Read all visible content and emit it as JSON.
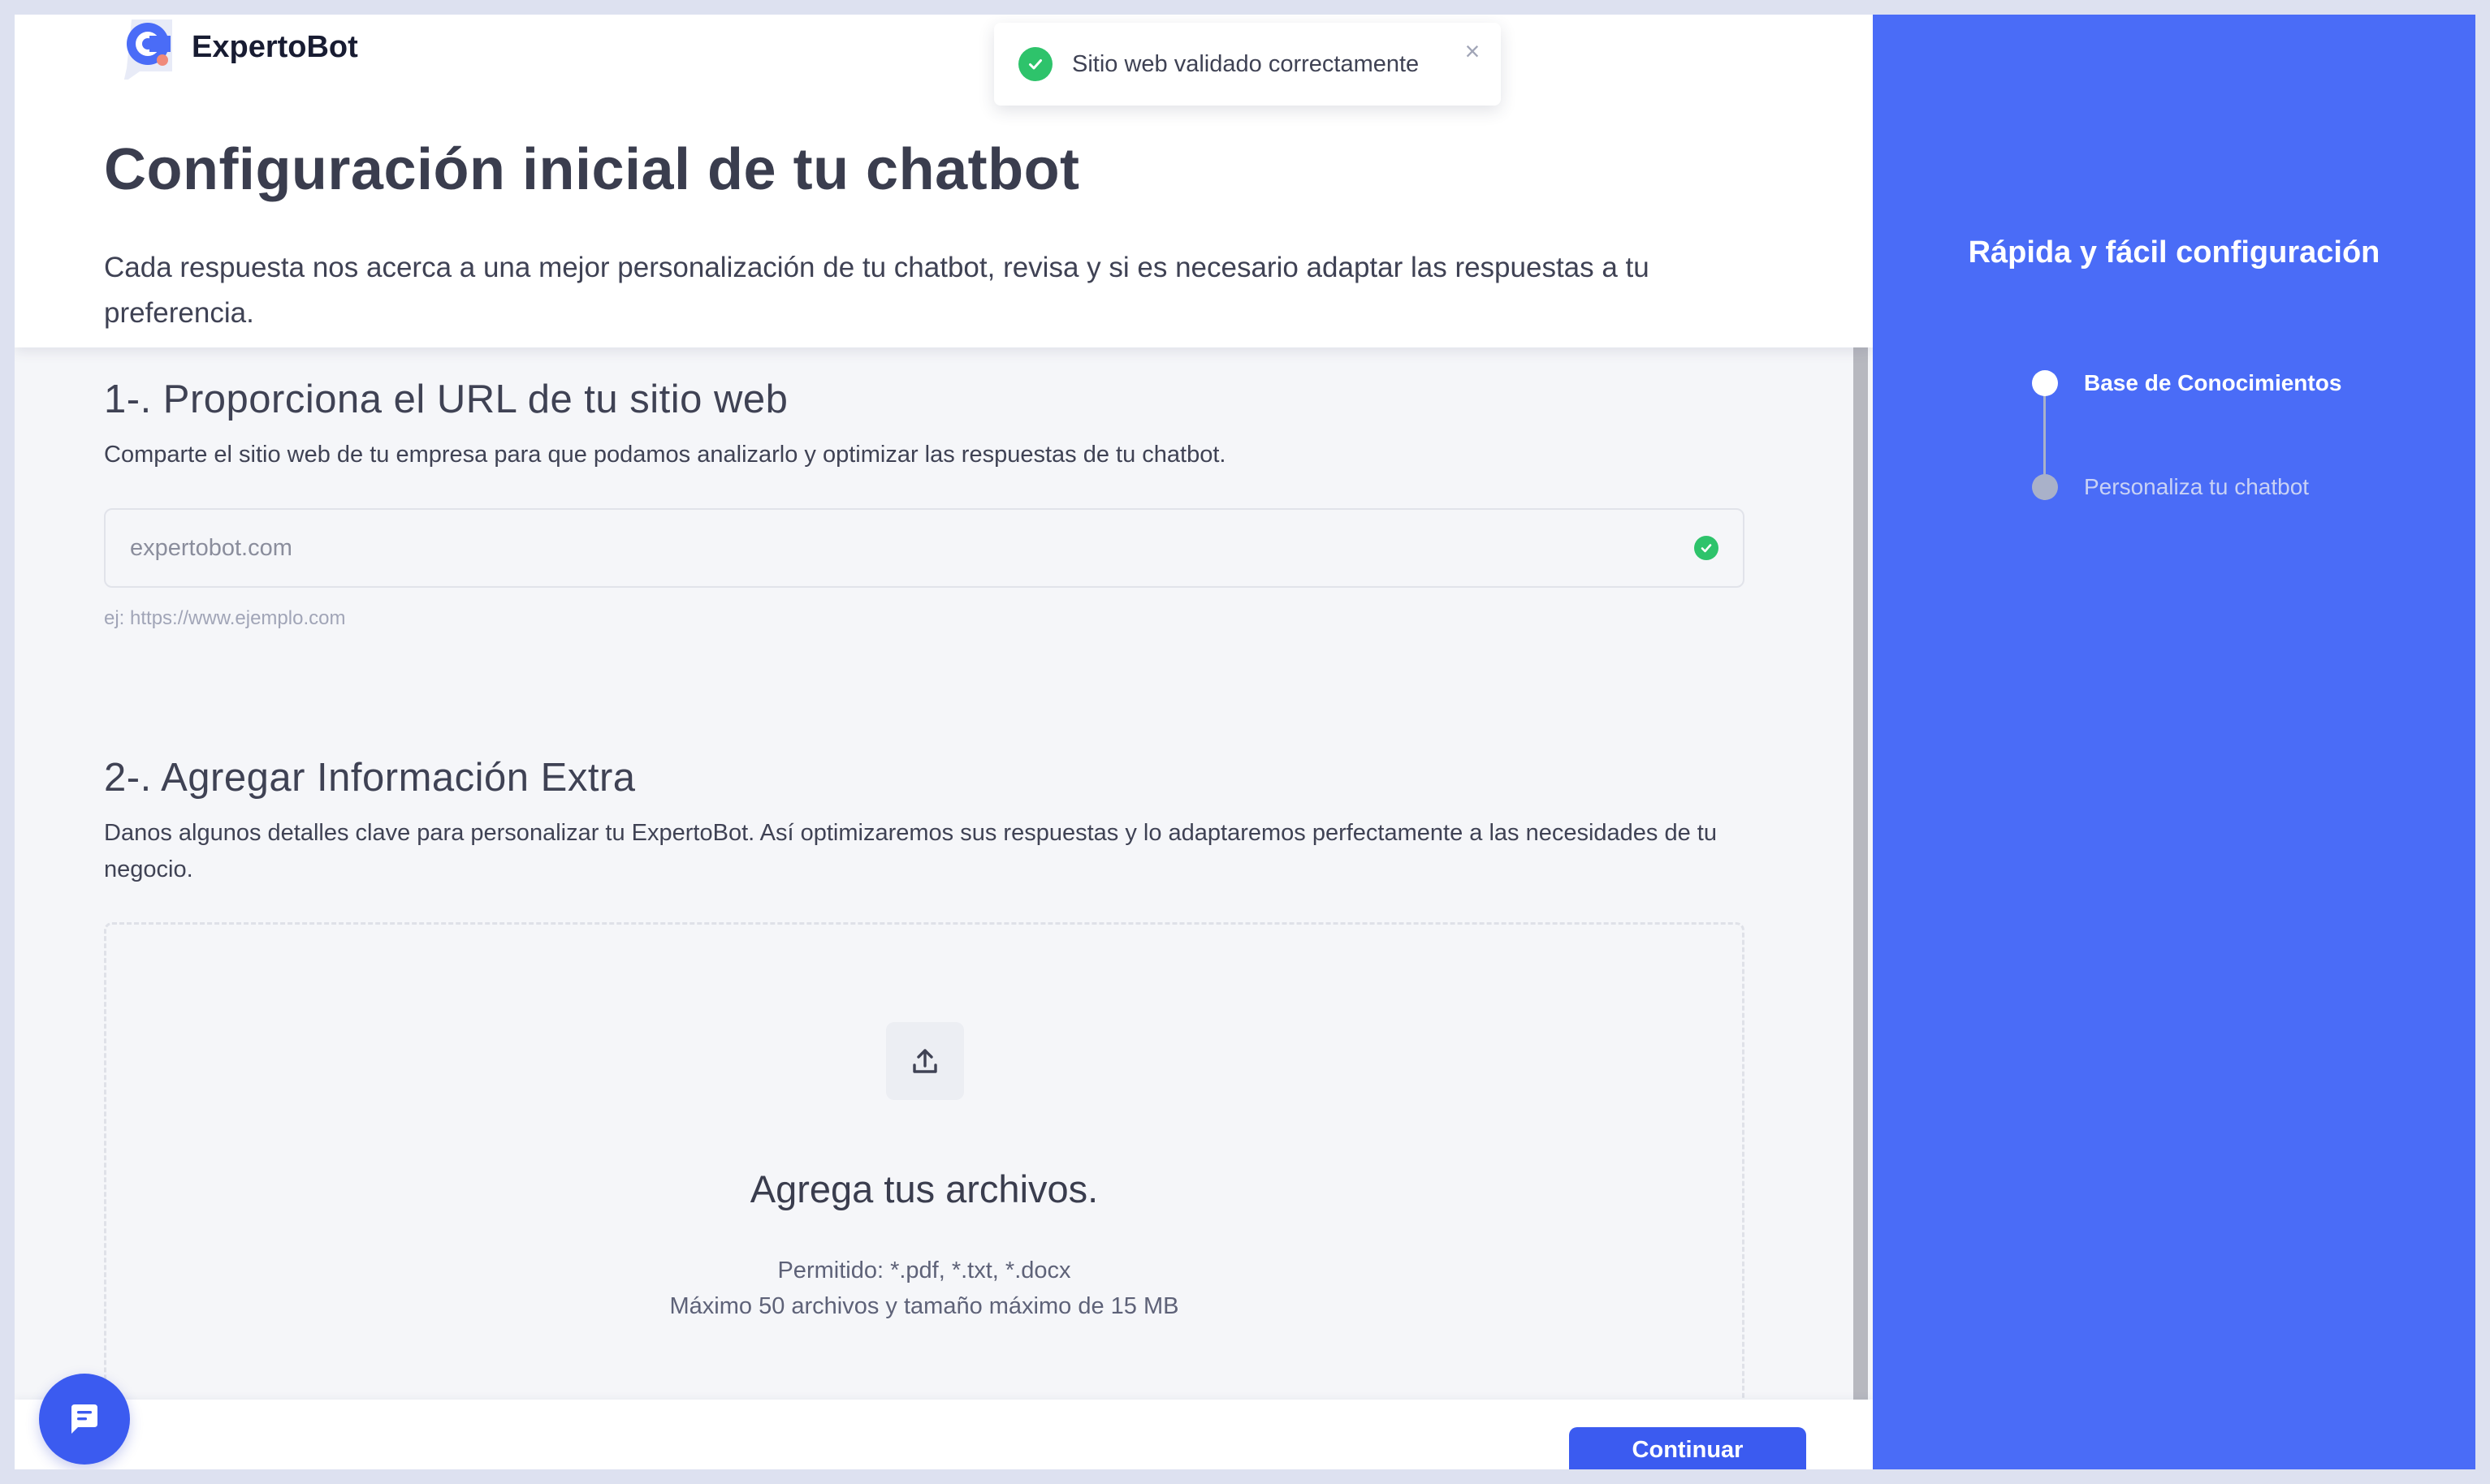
{
  "app": {
    "name": "ExpertoBot"
  },
  "toast": {
    "message": "Sitio web validado correctamente",
    "close": "×"
  },
  "header": {
    "title": "Configuración inicial de tu chatbot",
    "description": "Cada respuesta nos acerca a una mejor personalización de tu chatbot, revisa y si es necesario adaptar las respuestas a tu preferencia."
  },
  "section1": {
    "title": "1-. Proporciona el URL de tu sitio web",
    "description": "Comparte el sitio web de tu empresa para que podamos analizarlo y optimizar las respuestas de tu chatbot.",
    "url_value": "expertobot.com",
    "hint": "ej: https://www.ejemplo.com"
  },
  "section2": {
    "title": "2-. Agregar Información Extra",
    "description": "Danos algunos detalles clave para personalizar tu ExpertoBot. Así optimizaremos sus respuestas y lo adaptaremos perfectamente a las necesidades de tu negocio.",
    "dropzone": {
      "title": "Agrega tus archivos.",
      "allowed": "Permitido: *.pdf, *.txt, *.docx",
      "limits": "Máximo 50 archivos y tamaño máximo de 15 MB"
    }
  },
  "footer": {
    "continue_label": "Continuar"
  },
  "sidebar": {
    "title": "Rápida y fácil configuración",
    "steps": [
      {
        "label": "Base de Conocimientos",
        "active": true
      },
      {
        "label": "Personaliza tu chatbot",
        "active": false
      }
    ]
  },
  "colors": {
    "primary": "#3b5bf0",
    "sidebar": "#4a6cf7",
    "success": "#2ec36b"
  },
  "icons": {
    "logo": "expertobot-logo",
    "toast": "check-circle-icon",
    "upload": "upload-icon",
    "chat": "chat-icon"
  }
}
